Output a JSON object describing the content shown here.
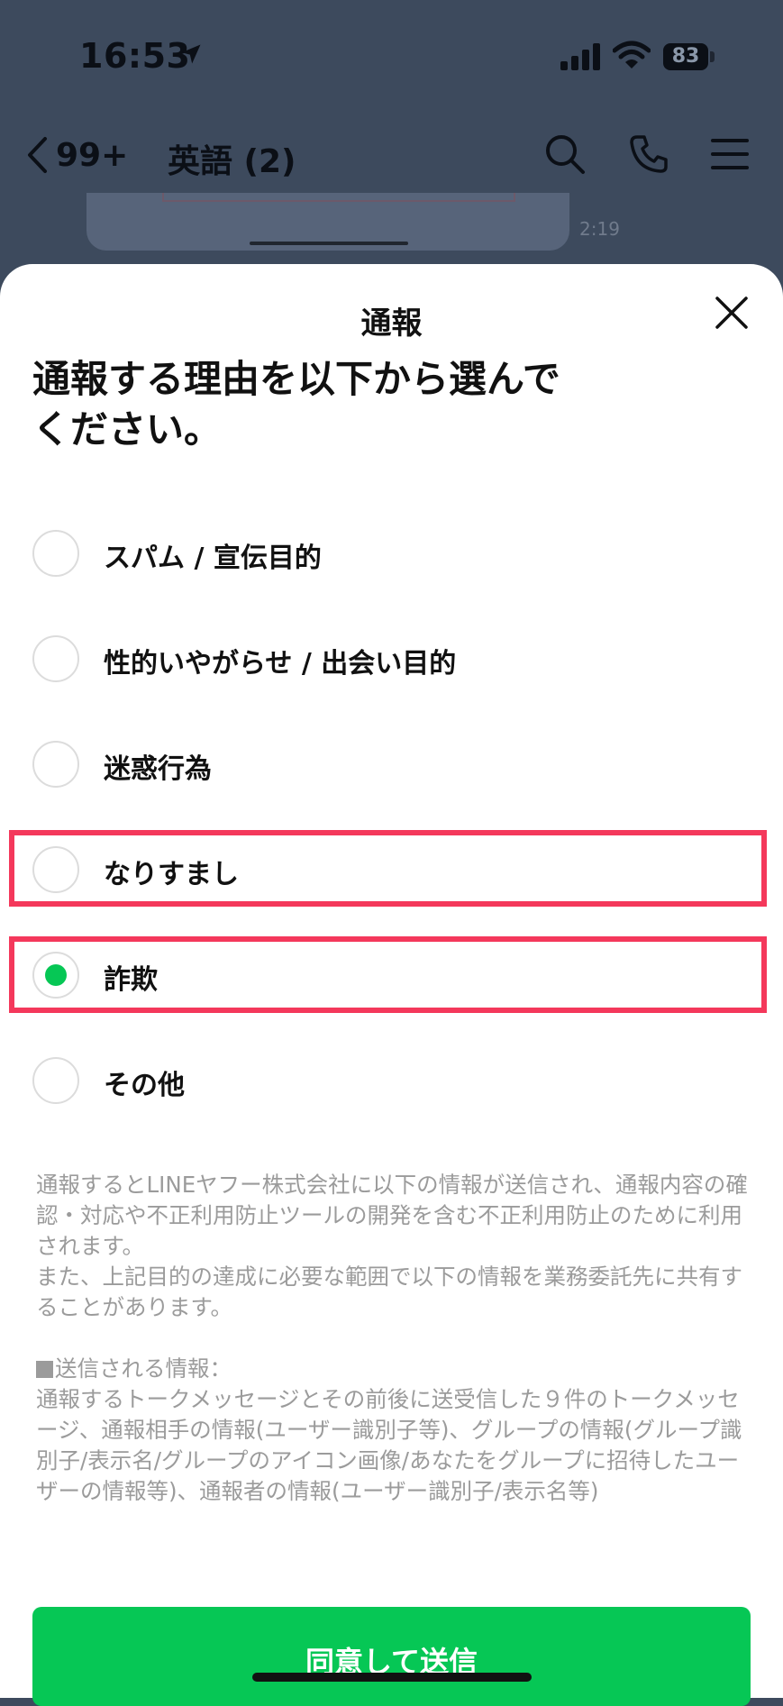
{
  "status_bar": {
    "time": "16:53",
    "battery": "83",
    "icons": [
      "location-arrow-icon",
      "cellular-signal-icon",
      "wifi-icon",
      "battery-icon"
    ]
  },
  "chat_header": {
    "back_count": "99+",
    "title": "英語 (2)",
    "message_time": "2:19",
    "icons": [
      "chevron-left-icon",
      "search-icon",
      "phone-icon",
      "menu-icon"
    ]
  },
  "sheet": {
    "title": "通報",
    "heading": "通報する理由を以下から選んでください。",
    "options": [
      {
        "label": "スパム / 宣伝目的",
        "selected": false
      },
      {
        "label": "性的いやがらせ / 出会い目的",
        "selected": false
      },
      {
        "label": "迷惑行為",
        "selected": false
      },
      {
        "label": "なりすまし",
        "selected": false
      },
      {
        "label": "詐欺",
        "selected": true
      },
      {
        "label": "その他",
        "selected": false
      }
    ],
    "notice_p1": "通報するとLINEヤフー株式会社に以下の情報が送信され、通報内容の確認・対応や不正利用防止ツールの開発を含む不正利用防止のために利用されます。",
    "notice_p2": "また、上記目的の達成に必要な範囲で以下の情報を業務委託先に共有することがあります。",
    "notice_heading": "送信される情報：",
    "notice_body": "通報するトークメッセージとその前後に送受信した９件のトークメッセージ、通報相手の情報(ユーザー識別子等)、グループの情報(グループ識別子/表示名/グループのアイコン画像/あなたをグループに招待したユーザーの情報等)、通報者の情報(ユーザー識別子/表示名等)",
    "submit_label": "同意して送信"
  },
  "colors": {
    "accent_green": "#06c755",
    "highlight_red": "#f4385b",
    "overlay": "#3d4a5d"
  }
}
